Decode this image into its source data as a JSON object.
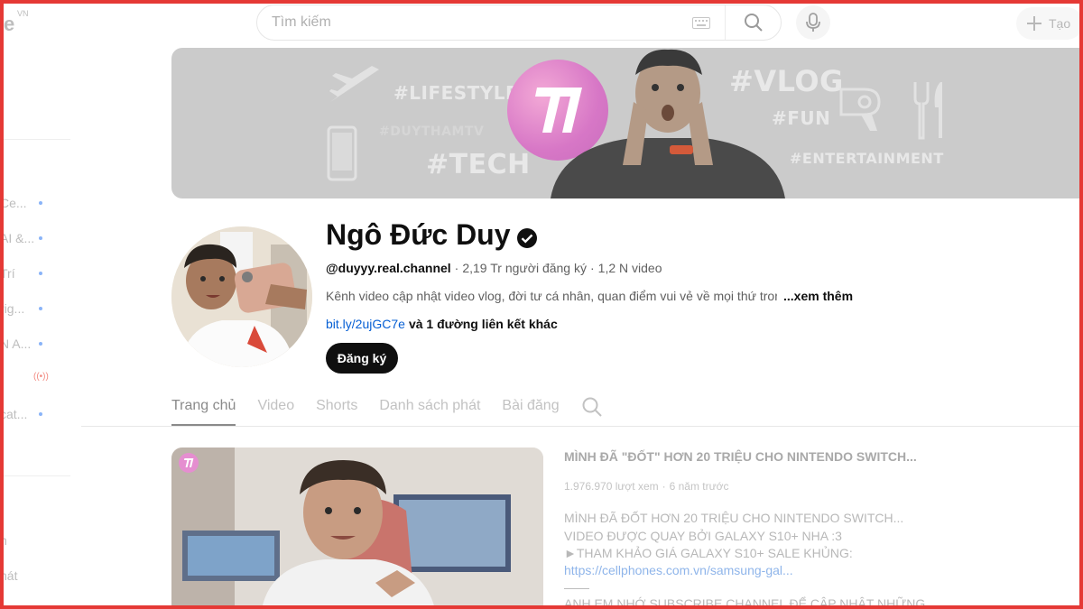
{
  "topbar": {
    "logo_fragment": "e",
    "logo_region": "VN",
    "search_placeholder": "Tìm kiếm",
    "create_label": "Tạo"
  },
  "sidebar": {
    "items": [
      {
        "label": "Ce...",
        "dot": true
      },
      {
        "label": "AI &...",
        "dot": true
      },
      {
        "label": "Trí",
        "dot": true
      },
      {
        "label": "rig...",
        "dot": true
      },
      {
        "label": "N A...",
        "dot": true
      },
      {
        "label": "",
        "live": true
      },
      {
        "label": "cat...",
        "dot": true
      },
      {
        "label": "n",
        "dot": false
      },
      {
        "label": "hát",
        "dot": false
      }
    ]
  },
  "banner": {
    "tags": [
      "#LIFESTYLE",
      "#DUYTHAMTV",
      "#TECH",
      "#VLOG",
      "#FUN",
      "#ENTERTAINMENT"
    ]
  },
  "channel": {
    "name": "Ngô Đức Duy",
    "handle": "@duyyy.real.channel",
    "subscribers": "2,19 Tr người đăng ký",
    "videos": "1,2 N video",
    "separator": "·",
    "description": "Kênh video cập nhật video vlog, đời tư cá nhân, quan điểm vui vẻ về mọi thứ trong",
    "more_label": "...xem thêm",
    "link": "bit.ly/2ujGC7e",
    "link_more": "và 1 đường liên kết khác",
    "subscribe_label": "Đăng ký"
  },
  "tabs": [
    {
      "label": "Trang chủ",
      "active": true
    },
    {
      "label": "Video",
      "active": false
    },
    {
      "label": "Shorts",
      "active": false
    },
    {
      "label": "Danh sách phát",
      "active": false
    },
    {
      "label": "Bài đăng",
      "active": false
    }
  ],
  "featured": {
    "title": "MÌNH ĐÃ \"ĐỐT\" HƠN 20 TRIỆU CHO NINTENDO SWITCH...",
    "views": "1.976.970 lượt xem",
    "age": "6 năm trước",
    "desc_lines": [
      "MÌNH ĐÃ ĐỐT HƠN 20 TRIỆU CHO NINTENDO SWITCH...",
      "VIDEO ĐƯỢC QUAY BỞI GALAXY S10+ NHA :3",
      "►THAM KHẢO GIÁ GALAXY S10+ SALE KHỦNG:"
    ],
    "desc_link": "https://cellphones.com.vn/samsung-gal...",
    "desc_sep": "——",
    "desc_last": "ANH EM NHỚ SUBSCRIBE CHANNEL ĐỂ CẬP NHẬT NHỮNG"
  },
  "colors": {
    "accent_blue": "#065fd4",
    "frame_red": "#e53935",
    "banner_pink": "#d777c6"
  }
}
